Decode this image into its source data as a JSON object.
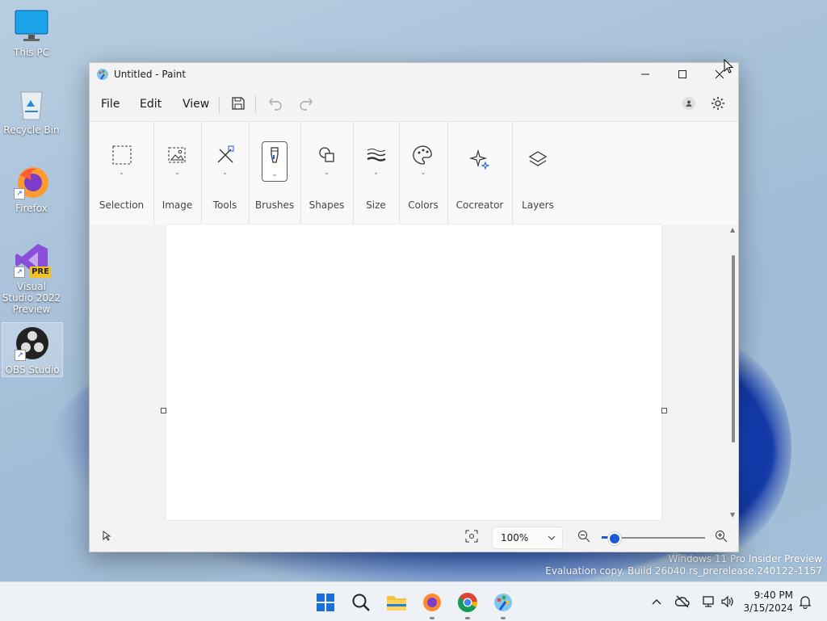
{
  "desktop": {
    "icons": [
      {
        "label": "This PC"
      },
      {
        "label": "Recycle Bin"
      },
      {
        "label": "Firefox"
      },
      {
        "label": "Visual Studio 2022 Preview",
        "badge": "PRE"
      },
      {
        "label": "OBS Studio"
      }
    ],
    "watermark": {
      "line1": "Windows 11 Pro Insider Preview",
      "line2": "Evaluation copy. Build 26040.rs_prerelease.240122-1157"
    }
  },
  "window": {
    "title": "Untitled - Paint",
    "menu": {
      "file": "File",
      "edit": "Edit",
      "view": "View"
    },
    "ribbon": {
      "groups": [
        {
          "label": "Selection",
          "icon": "selection-icon"
        },
        {
          "label": "Image",
          "icon": "image-icon"
        },
        {
          "label": "Tools",
          "icon": "tools-icon"
        },
        {
          "label": "Brushes",
          "icon": "brush-icon"
        },
        {
          "label": "Shapes",
          "icon": "shapes-icon"
        },
        {
          "label": "Size",
          "icon": "size-icon"
        },
        {
          "label": "Colors",
          "icon": "palette-icon"
        },
        {
          "label": "Cocreator",
          "icon": "sparkle-icon"
        },
        {
          "label": "Layers",
          "icon": "layers-icon"
        }
      ],
      "active_group": "Brushes"
    },
    "status": {
      "zoom": "100%",
      "zoom_slider_fraction": 0.12
    }
  },
  "taskbar": {
    "apps": [
      "start-icon",
      "search-icon",
      "file-explorer-icon",
      "firefox-icon",
      "chrome-icon",
      "paint-icon"
    ],
    "time": "9:40 PM",
    "date": "3/15/2024"
  },
  "colors": {
    "accent": "#1a5ad8",
    "window_bg": "#f3f3f3",
    "ribbon_bg": "#f9f9f9"
  }
}
